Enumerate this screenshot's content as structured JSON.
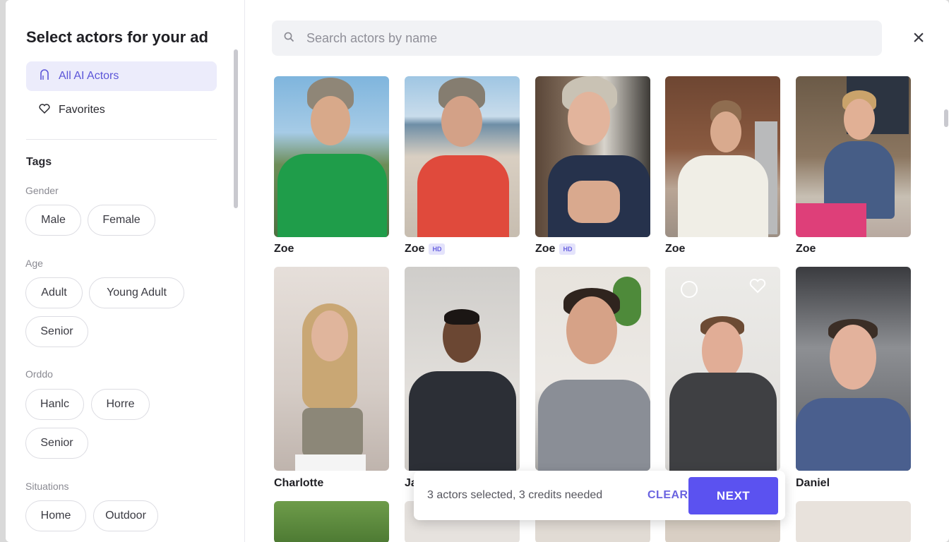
{
  "sidebar": {
    "title": "Select actors for your ad",
    "nav": [
      {
        "label": "All AI Actors",
        "icon": "people-icon",
        "active": true
      },
      {
        "label": "Favorites",
        "icon": "heart-icon",
        "active": false
      }
    ],
    "tags_title": "Tags",
    "groups": [
      {
        "label": "Gender",
        "chips": [
          "Male",
          "Female"
        ]
      },
      {
        "label": "Age",
        "chips": [
          "Adult",
          "Young Adult",
          "Senior"
        ]
      },
      {
        "label": "Orddo",
        "chips": [
          "Hanlc",
          "Horre",
          "Senior"
        ]
      },
      {
        "label": "Situations",
        "chips": [
          "Home",
          "Outdoor"
        ]
      }
    ]
  },
  "search": {
    "placeholder": "Search actors by name",
    "icon": "search-icon"
  },
  "close": {
    "icon": "close-icon",
    "glyph": "×"
  },
  "actors": [
    {
      "name": "Zoe",
      "hd": false
    },
    {
      "name": "Zoe",
      "hd": true,
      "badge": "HD"
    },
    {
      "name": "Zoe",
      "hd": true,
      "badge": "HD"
    },
    {
      "name": "Zoe",
      "hd": false
    },
    {
      "name": "Zoe",
      "hd": false
    },
    {
      "name": "Charlotte",
      "hd": false
    },
    {
      "name": "Ja",
      "hd": false
    },
    {
      "name": "",
      "hd": false
    },
    {
      "name": "",
      "hd": false
    },
    {
      "name": "Daniel",
      "hd": false
    }
  ],
  "selection": {
    "message": "3 actors selected, 3 credits needed",
    "clear_label": "CLEAR",
    "next_label": "NEXT"
  },
  "colors": {
    "accent": "#5b52f0",
    "accent_text": "#6a63e0",
    "active_nav_bg": "#ececfb"
  }
}
